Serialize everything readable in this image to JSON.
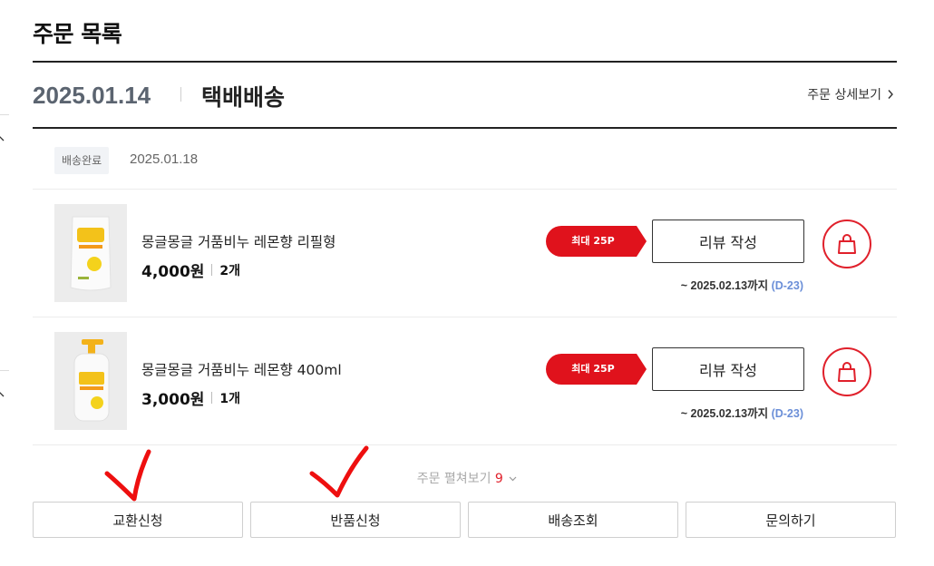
{
  "page": {
    "title": "주문 목록"
  },
  "order": {
    "date": "2025.01.14",
    "type": "택배배송",
    "detail_link": "주문 상세보기",
    "status": "배송완료",
    "delivery_date": "2025.01.18"
  },
  "items": [
    {
      "name": "몽글몽글 거품비누 레몬향 리필형",
      "price": "4,000원",
      "qty": "2개",
      "point_badge": "최대 25P",
      "review_label": "리뷰 작성",
      "deadline": "~ 2025.02.13까지",
      "dday": "(D-23)"
    },
    {
      "name": "몽글몽글 거품비누 레몬향 400ml",
      "price": "3,000원",
      "qty": "1개",
      "point_badge": "최대 25P",
      "review_label": "리뷰 작성",
      "deadline": "~ 2025.02.13까지",
      "dday": "(D-23)"
    }
  ],
  "expand": {
    "label": "주문 펼쳐보기",
    "count": "9"
  },
  "actions": {
    "exchange": "교환신청",
    "return": "반품신청",
    "tracking": "배송조회",
    "inquiry": "문의하기"
  },
  "icons": {
    "detail": "chevron-right-icon",
    "cart": "shopping-bag-icon",
    "expand": "chevron-down-icon",
    "annotation": "red-checkmark"
  },
  "colors": {
    "accent": "#e0202b",
    "dday": "#6b8fd8",
    "date": "#5b6470"
  }
}
